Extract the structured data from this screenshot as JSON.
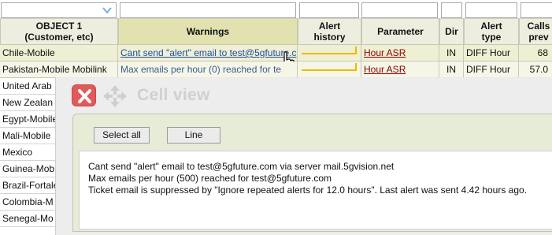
{
  "columns": {
    "object": "OBJECT 1\n(Customer, etc)",
    "warnings": "Warnings",
    "alert_history": "Alert\nhistory",
    "parameter": "Parameter",
    "dir": "Dir",
    "alert_type": "Alert\ntype",
    "calls_prev": "Calls\nprev"
  },
  "rows": [
    {
      "object": "Chile-Mobile",
      "warning": "Cant send \"alert\" email to test@5gfuture.c",
      "parameter": "Hour ASR",
      "dir": "IN",
      "alert_type": "DIFF Hour",
      "calls_prev": "68"
    },
    {
      "object": "Pakistan-Mobile Mobilink",
      "warning": "Max emails per hour (0) reached for te",
      "parameter": "Hour ASR",
      "dir": "IN",
      "alert_type": "DIFF Hour",
      "calls_prev": "57.0"
    }
  ],
  "left_rows": [
    "United Arab",
    "New Zealan",
    "Egypt-Mobile",
    "Mali-Mobile",
    "Mexico",
    "Guinea-Mob",
    "Brazil-Fortale",
    "Colombia-M",
    "Senegal-Mo"
  ],
  "cell_view": {
    "title": "Cell view",
    "select_all": "Select all",
    "line": "Line",
    "lines": [
      "Cant send \"alert\" email to test@5gfuture.com via server mail.5gvision.net",
      "Max emails per hour (500) reached for test@5gfuture.com",
      "Ticket email is suppressed by \"Ignore repeated alerts for 12.0 hours\". Last alert was sent 4.42 hours ago."
    ]
  },
  "colors": {
    "accent_yellow": "#f0b800",
    "close_red": "#e05a5a",
    "link_red": "#8b0000"
  }
}
